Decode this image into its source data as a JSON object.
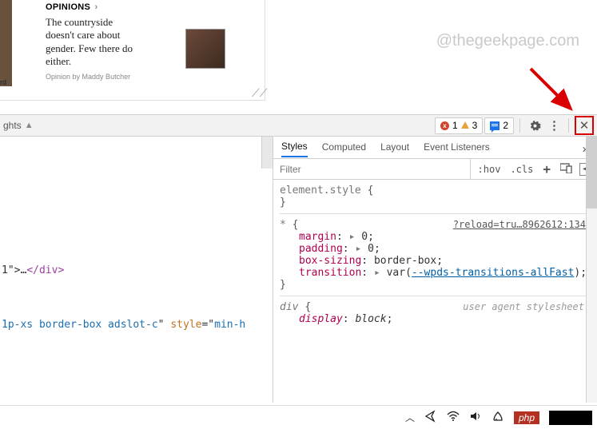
{
  "page": {
    "strip_label": "rd",
    "opinions": {
      "header": "OPINIONS",
      "chevron": "›",
      "title": "The countryside doesn't care about gender. Few there do either.",
      "byline_prefix": "Opinion by",
      "byline_author": "Maddy Butcher"
    }
  },
  "watermark": "@thegeekpage.com",
  "toolbar": {
    "left_label": "ghts",
    "errors": "1",
    "warnings": "3",
    "messages": "2",
    "close_glyph": "✕",
    "more_glyph": "⋮"
  },
  "elements": {
    "line1_pre": "1\">…",
    "line1_close": "</div>",
    "line2_attr1": "1p-xs border-box adslot-c",
    "line2_attr2_name": "style",
    "line2_attr2_val": "min-h"
  },
  "styles": {
    "tabs": [
      "Styles",
      "Computed",
      "Layout",
      "Event Listeners"
    ],
    "more_glyph": "»",
    "filter_placeholder": "Filter",
    "tools": {
      "hov": ":hov",
      "cls": ".cls",
      "plus": "+"
    },
    "rule_element": {
      "selector": "element.style",
      "open": "{",
      "close": "}"
    },
    "rule_star": {
      "selector": "*",
      "open": "{",
      "link": "?reload=tru…8962612:134",
      "decls": [
        {
          "prop": "margin",
          "sep": ":",
          "tri": "▸",
          "val": "0",
          "semi": ";"
        },
        {
          "prop": "padding",
          "sep": ":",
          "tri": "▸",
          "val": "0",
          "semi": ";"
        },
        {
          "prop": "box-sizing",
          "sep": ":",
          "val": "border-box",
          "semi": ";"
        },
        {
          "prop": "transition",
          "sep": ":",
          "tri": "▸",
          "fn": "var(",
          "var": "--wpds-transitions-allFast",
          "fnclose": ")",
          "semi": ";"
        }
      ],
      "close": "}"
    },
    "rule_div": {
      "selector": "div",
      "open": "{",
      "source": "user agent stylesheet",
      "decls": [
        {
          "prop": "display",
          "sep": ":",
          "val": "block",
          "semi": ";"
        }
      ]
    }
  },
  "taskbar": {
    "php": "php"
  }
}
